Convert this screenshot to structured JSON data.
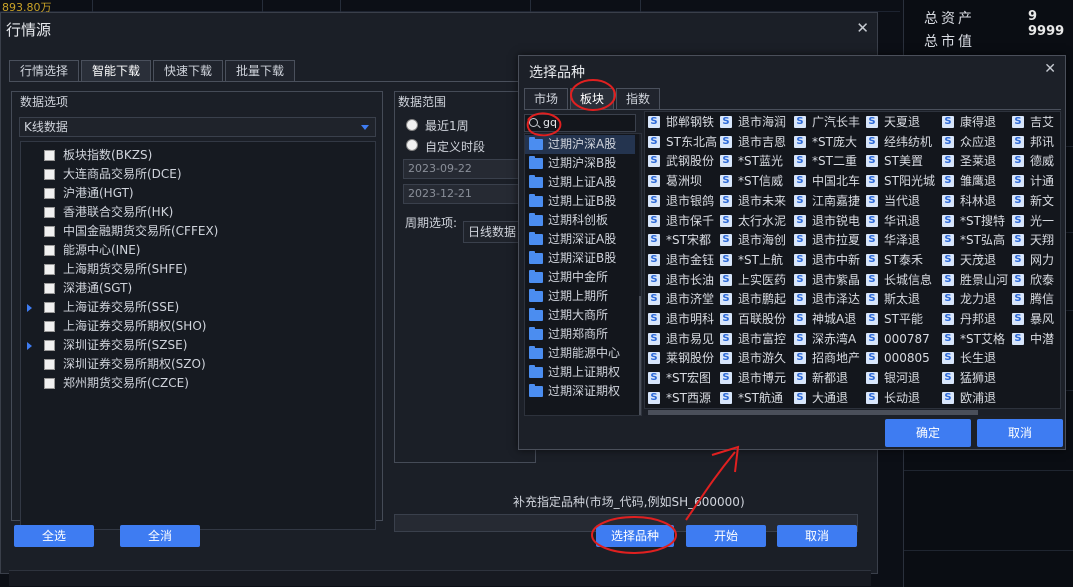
{
  "background": {
    "top_value": "893.80万",
    "right_panel": {
      "row1": "总资产",
      "row1_value": "9 9999",
      "row2": "总市值"
    }
  },
  "main_dialog": {
    "title": "行情源",
    "close": "✕",
    "tabs": [
      "行情选择",
      "智能下载",
      "快速下载",
      "批量下载"
    ],
    "data_options_label": "数据选项",
    "data_type": "K线数据",
    "data_items": [
      {
        "label": "板块指数(BKZS)",
        "expand": false
      },
      {
        "label": "大连商品交易所(DCE)",
        "expand": false
      },
      {
        "label": "沪港通(HGT)",
        "expand": false
      },
      {
        "label": "香港联合交易所(HK)",
        "expand": false
      },
      {
        "label": "中国金融期货交易所(CFFEX)",
        "expand": false
      },
      {
        "label": "能源中心(INE)",
        "expand": false
      },
      {
        "label": "上海期货交易所(SHFE)",
        "expand": false
      },
      {
        "label": "深港通(SGT)",
        "expand": false
      },
      {
        "label": "上海证券交易所(SSE)",
        "expand": true
      },
      {
        "label": "上海证券交易所期权(SHO)",
        "expand": false
      },
      {
        "label": "深圳证券交易所(SZSE)",
        "expand": true
      },
      {
        "label": "深圳证券交易所期权(SZO)",
        "expand": false
      },
      {
        "label": "郑州期货交易所(CZCE)",
        "expand": false
      }
    ],
    "range_label": "数据范围",
    "radio_recent": "最近1周",
    "radio_custom": "自定义时段",
    "date_start": "2023-09-22",
    "date_end": "2023-12-21",
    "period_label": "周期选项:",
    "period_value": "日线数据",
    "supplement_label": "补充指定品种(市场_代码,例如SH_600000)",
    "buttons": {
      "select_all": "全选",
      "deselect_all": "全消",
      "select_variety": "选择品种",
      "start": "开始",
      "cancel": "取消"
    }
  },
  "sub_dialog": {
    "title": "选择品种",
    "close": "✕",
    "tabs": [
      "市场",
      "板块",
      "指数"
    ],
    "search_text": "gq",
    "folders": [
      "过期沪深A股",
      "过期沪深B股",
      "过期上证A股",
      "过期上证B股",
      "过期科创板",
      "过期深证A股",
      "过期深证B股",
      "过期中金所",
      "过期上期所",
      "过期大商所",
      "过期郑商所",
      "过期能源中心",
      "过期上证期权",
      "过期深证期权"
    ],
    "grid": [
      [
        "邯郸钢铁",
        "退市海润",
        "广汽长丰",
        "天夏退",
        "康得退",
        "吉艾"
      ],
      [
        "ST东北高",
        "退市吉恩",
        "*ST庞大",
        "经纬纺机",
        "众应退",
        "邦讯"
      ],
      [
        "武钢股份",
        "*ST蓝光",
        "*ST二重",
        "ST美置",
        "圣莱退",
        "德威"
      ],
      [
        "葛洲坝",
        "*ST信威",
        "中国北车",
        "ST阳光城",
        "雏鹰退",
        "计通"
      ],
      [
        "退市银鸽",
        "退市未来",
        "江南嘉捷",
        "当代退",
        "科林退",
        "新文"
      ],
      [
        "退市保千",
        "太行水泥",
        "退市锐电",
        "华讯退",
        "*ST搜特",
        "光一"
      ],
      [
        "*ST宋都",
        "退市海创",
        "退市拉夏",
        "华泽退",
        "*ST弘高",
        "天翔"
      ],
      [
        "退市金钰",
        "*ST上航",
        "退市中新",
        "ST泰禾",
        "天茂退",
        "网力"
      ],
      [
        "退市长油",
        "上实医药",
        "退市紫晶",
        "长城信息",
        "胜景山河",
        "欣泰"
      ],
      [
        "退市济堂",
        "退市鹏起",
        "退市泽达",
        "斯太退",
        "龙力退",
        "腾信"
      ],
      [
        "退市明科",
        "百联股份",
        "神城A退",
        "ST平能",
        "丹邦退",
        "暴风"
      ],
      [
        "退市易见",
        "退市富控",
        "深赤湾A",
        "000787",
        "*ST艾格",
        "中潜"
      ],
      [
        "莱钢股份",
        "退市游久",
        "招商地产",
        "000805",
        "长生退",
        ""
      ],
      [
        "*ST宏图",
        "退市博元",
        "新都退",
        "银河退",
        "猛狮退",
        ""
      ],
      [
        "*ST西源",
        "*ST航通",
        "大通退",
        "长动退",
        "欧浦退",
        ""
      ]
    ],
    "badge": "S",
    "buttons": {
      "ok": "确定",
      "cancel": "取消"
    }
  }
}
